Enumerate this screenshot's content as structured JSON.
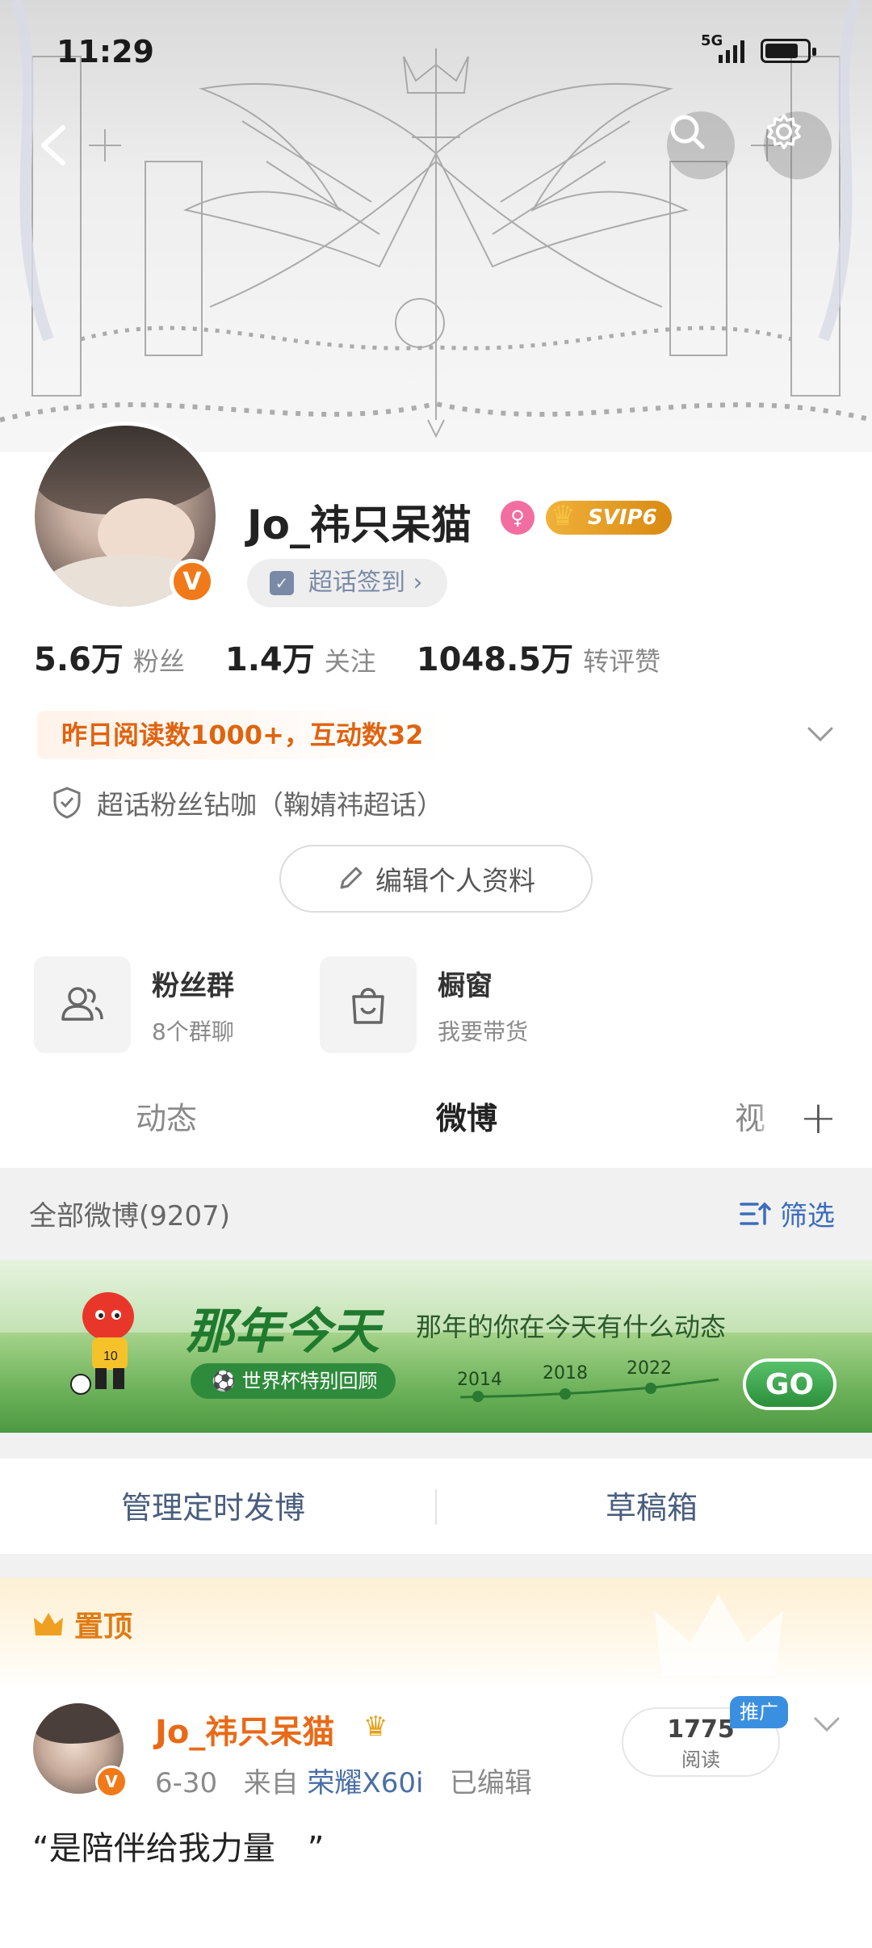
{
  "status_bar": {
    "time": "11:29",
    "network": "5G"
  },
  "profile": {
    "username": "Jo_祎只呆猫",
    "svip_label": "SVIP6",
    "chaohua_checkin": "超话签到 ›",
    "stats": [
      {
        "num": "5.6万",
        "label": "粉丝"
      },
      {
        "num": "1.4万",
        "label": "关注"
      },
      {
        "num": "1048.5万",
        "label": "转评赞"
      }
    ],
    "yesterday": "昨日阅读数1000+，互动数32",
    "fan_diamond": "超话粉丝钻咖（鞠婧祎超话）",
    "edit_profile": "编辑个人资料"
  },
  "tools": [
    {
      "title": "粉丝群",
      "subtitle": "8个群聊"
    },
    {
      "title": "橱窗",
      "subtitle": "我要带货"
    }
  ],
  "tabs": {
    "t1": "动态",
    "t2": "微博",
    "t3": "视"
  },
  "feed": {
    "all_weibo": "全部微博(9207)",
    "filter": "筛选",
    "promo": {
      "title": "那年今天",
      "subtitle": "那年的你在今天有什么动态",
      "pill": "世界杯特别回顾",
      "years": [
        "2014",
        "2018",
        "2022"
      ],
      "go": "GO"
    },
    "manage_scheduled": "管理定时发博",
    "drafts": "草稿箱",
    "pinned_label": "置顶",
    "post": {
      "author": "Jo_祎只呆猫",
      "date": "6-30",
      "from_label": "来自",
      "device": "荣耀X60i",
      "edited": "已编辑",
      "reads": "1775",
      "reads_label": "阅读",
      "promote": "推广",
      "text": "“是陪伴给我力量　”"
    }
  },
  "colors": {
    "accent_orange": "#e86a17",
    "link_blue": "#3b6dbb",
    "verified_orange": "#f07a1a"
  }
}
